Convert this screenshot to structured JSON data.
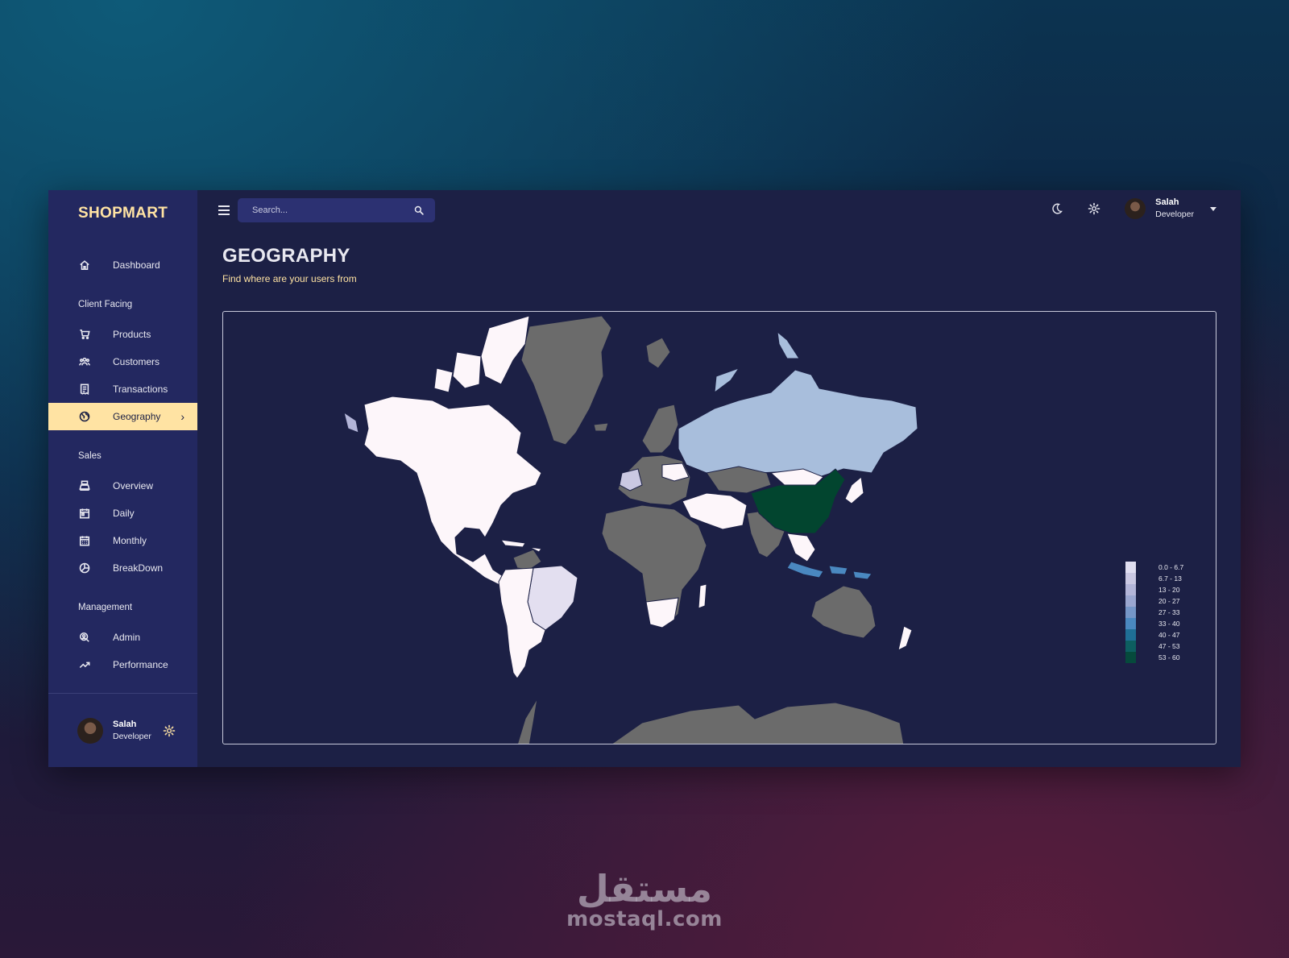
{
  "brand": "SHOPMART",
  "sidebar": {
    "top_item": {
      "label": "Dashboard",
      "icon": "home-icon"
    },
    "sections": [
      {
        "title": "Client Facing",
        "items": [
          {
            "label": "Products",
            "icon": "cart-icon"
          },
          {
            "label": "Customers",
            "icon": "users-icon"
          },
          {
            "label": "Transactions",
            "icon": "receipt-icon"
          },
          {
            "label": "Geography",
            "icon": "globe-icon",
            "active": true
          }
        ]
      },
      {
        "title": "Sales",
        "items": [
          {
            "label": "Overview",
            "icon": "point-of-sale-icon"
          },
          {
            "label": "Daily",
            "icon": "calendar-today-icon"
          },
          {
            "label": "Monthly",
            "icon": "calendar-month-icon"
          },
          {
            "label": "BreakDown",
            "icon": "pie-chart-icon"
          }
        ]
      },
      {
        "title": "Management",
        "items": [
          {
            "label": "Admin",
            "icon": "admin-icon"
          },
          {
            "label": "Performance",
            "icon": "trending-up-icon"
          }
        ]
      }
    ],
    "footer": {
      "name": "Salah",
      "role": "Developer"
    }
  },
  "topbar": {
    "search_placeholder": "Search...",
    "user": {
      "name": "Salah",
      "role": "Developer"
    }
  },
  "page": {
    "title": "GEOGRAPHY",
    "subtitle": "Find where are your users from"
  },
  "map": {
    "legend": [
      {
        "label": "0.0 - 6.7",
        "color": "#e0def0"
      },
      {
        "label": "6.7 - 13",
        "color": "#cac8e2"
      },
      {
        "label": "13 - 20",
        "color": "#b3b5d8"
      },
      {
        "label": "20 - 27",
        "color": "#9aa6d0"
      },
      {
        "label": "27 - 33",
        "color": "#7596c8"
      },
      {
        "label": "33 - 40",
        "color": "#4a88c0"
      },
      {
        "label": "40 - 47",
        "color": "#1f6f96"
      },
      {
        "label": "47 - 53",
        "color": "#0d5f60"
      },
      {
        "label": "53 - 60",
        "color": "#064a3c"
      }
    ],
    "colors": {
      "no_data": "#6b6b6b",
      "low": "#fdf6fa",
      "russia": "#a8bedc",
      "china": "#02452f",
      "indonesia": "#4a88c0",
      "brazil": "#e3dff0"
    }
  },
  "watermark": {
    "arabic": "مستقل",
    "latin": "mostaql.com"
  }
}
